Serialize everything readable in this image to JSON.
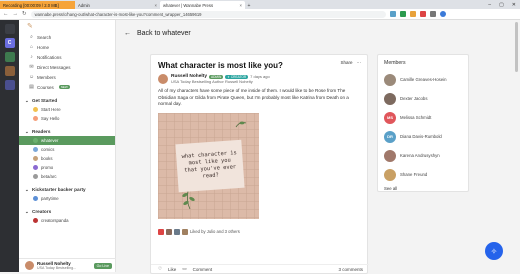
{
  "browser": {
    "tabs": [
      {
        "label": "Recording [00:00:09 / 2.0 MB]"
      },
      {
        "label": "Admin"
      },
      {
        "label": "whatever | Wannabe Press"
      }
    ],
    "url": "wannabe.press/c/hang-out/what-character-is-most-like-you?comment_wrapper_14659619",
    "new_tab": "+",
    "back": "←",
    "forward": "→",
    "reload": "↻"
  },
  "dock": [
    {
      "letter": "",
      "color": "#3b3e45"
    },
    {
      "letter": "C",
      "color": "#6b6ee0"
    },
    {
      "letter": "",
      "color": "#3e7a4f"
    },
    {
      "letter": "",
      "color": "#8a5f3a"
    },
    {
      "letter": "",
      "color": "#4a4f8f"
    }
  ],
  "sidebar": {
    "logo": "✎",
    "items": [
      {
        "icon": "⌕",
        "label": "Search"
      },
      {
        "icon": "⌂",
        "label": "Home"
      },
      {
        "icon": "♪",
        "label": "Notifications"
      },
      {
        "icon": "✉",
        "label": "Direct Messages"
      },
      {
        "icon": "☺",
        "label": "Members"
      },
      {
        "icon": "▤",
        "label": "Courses",
        "badge": "NEW"
      }
    ],
    "sections": [
      {
        "title": "Get Started",
        "channels": [
          {
            "label": "Start Here",
            "color": "#f2c14e"
          },
          {
            "label": "Say Hello",
            "color": "#f59e7a"
          }
        ]
      },
      {
        "title": "Readers",
        "channels": [
          {
            "label": "whatever",
            "color": "#6cb06f",
            "active": true
          },
          {
            "label": "comics",
            "color": "#7aa7d9"
          },
          {
            "label": "books",
            "color": "#c6a27a"
          },
          {
            "label": "promo",
            "color": "#8b6ad1"
          },
          {
            "label": "beta/arc",
            "color": "#9a9a9a"
          }
        ]
      },
      {
        "title": "Kickstarter backer party",
        "channels": [
          {
            "label": "partytime",
            "color": "#5c8fd6"
          }
        ]
      },
      {
        "title": "Creators",
        "channels": [
          {
            "label": "creatorspanda",
            "color": "#b33"
          }
        ]
      }
    ],
    "me": {
      "name": "Russell Nohelty",
      "sub": "USA Today Bestselling...",
      "button": "Go Live"
    }
  },
  "main": {
    "back_label": "Back to whatever",
    "post": {
      "title": "What character is most like you?",
      "share": "Share",
      "more": "⋯",
      "author": "Russell Nohelty",
      "badge1": "ADMIN",
      "badge2": "✦ CREATOR",
      "time": "7 days ago",
      "author_sub": "USA Today Bestselling Author Russell Nohelty",
      "body": "All of my characters have some piece of me inside of them. I would like to be Rose from The Obsidian Saga or Gilda from Pirate Queen, but I'm probably most like Katrina from Death on a normal day.",
      "image_text": "what character is most like you that you've ever read?",
      "liked_by": "Liked by Julio and 3 others",
      "like": "Like",
      "comment": "Comment",
      "comments_count": "3 comments"
    }
  },
  "members": {
    "title": "Members",
    "list": [
      {
        "name": "Camille Greaves-Hosein",
        "initials": "",
        "color": "#9b8a7a"
      },
      {
        "name": "Dexter Jacobs",
        "initials": "",
        "color": "#7d6a5f"
      },
      {
        "name": "Melissa Schmidt",
        "initials": "MS",
        "color": "#e0565b"
      },
      {
        "name": "Diana Davis-Rumbold",
        "initials": "DR",
        "color": "#5aa0c8"
      },
      {
        "name": "Karena Andrusyshyn",
        "initials": "",
        "color": "#a0786a"
      },
      {
        "name": "Shane Freund",
        "initials": "",
        "color": "#c9a064"
      }
    ],
    "see_all": "See all"
  }
}
